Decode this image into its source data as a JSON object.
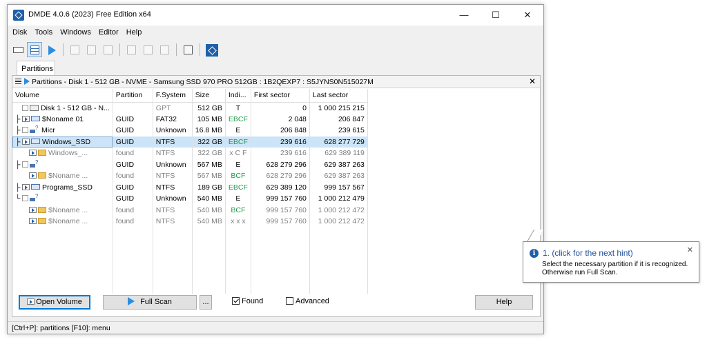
{
  "window": {
    "title": "DMDE 4.0.6 (2023) Free Edition x64",
    "minimize": "—",
    "maximize": "☐",
    "close": "✕"
  },
  "menu": [
    "Disk",
    "Tools",
    "Windows",
    "Editor",
    "Help"
  ],
  "tab": {
    "label": "Partitions"
  },
  "panel": {
    "title": "Partitions - Disk 1 - 512 GB - NVME - Samsung SSD 970 PRO 512GB : 1B2QEXP7 : S5JYNS0N515027M",
    "close": "✕"
  },
  "columns": [
    "Volume",
    "Partition",
    "F.System",
    "Size",
    "Indi...",
    "First sector",
    "Last sector"
  ],
  "rows": [
    {
      "volume": "Disk 1 - 512 GB - N...",
      "partition": "",
      "fs": "GPT",
      "size": "512 GB",
      "ind": "T",
      "first": "0",
      "last": "1 000 215 215"
    },
    {
      "volume": "$Noname 01",
      "partition": "GUID",
      "fs": "FAT32",
      "size": "105 MB",
      "ind": "EBCF",
      "first": "2 048",
      "last": "206 847"
    },
    {
      "volume": "Micr",
      "partition": "GUID",
      "fs": "Unknown",
      "size": "16.8 MB",
      "ind": "E",
      "first": "206 848",
      "last": "239 615"
    },
    {
      "volume": "Windows_SSD",
      "partition": "GUID",
      "fs": "NTFS",
      "size": "322 GB",
      "ind": "EBCF",
      "first": "239 616",
      "last": "628 277 729"
    },
    {
      "volume": "Windows_...",
      "partition": "found",
      "fs": "NTFS",
      "size": "322 GB",
      "ind": "x C F",
      "first": "239 616",
      "last": "629 389 119"
    },
    {
      "volume": "",
      "partition": "GUID",
      "fs": "Unknown",
      "size": "567 MB",
      "ind": "E",
      "first": "628 279 296",
      "last": "629 387 263"
    },
    {
      "volume": "$Noname ...",
      "partition": "found",
      "fs": "NTFS",
      "size": "567 MB",
      "ind": "BCF",
      "first": "628 279 296",
      "last": "629 387 263"
    },
    {
      "volume": "Programs_SSD",
      "partition": "GUID",
      "fs": "NTFS",
      "size": "189 GB",
      "ind": "EBCF",
      "first": "629 389 120",
      "last": "999 157 567"
    },
    {
      "volume": "",
      "partition": "GUID",
      "fs": "Unknown",
      "size": "540 MB",
      "ind": "E",
      "first": "999 157 760",
      "last": "1 000 212 479"
    },
    {
      "volume": "$Noname ...",
      "partition": "found",
      "fs": "NTFS",
      "size": "540 MB",
      "ind": "BCF",
      "first": "999 157 760",
      "last": "1 000 212 472"
    },
    {
      "volume": "$Noname ...",
      "partition": "found",
      "fs": "NTFS",
      "size": "540 MB",
      "ind": "x x x",
      "first": "999 157 760",
      "last": "1 000 212 472"
    }
  ],
  "buttons": {
    "open_volume": "Open Volume",
    "full_scan": "Full Scan",
    "dots": "...",
    "help": "Help"
  },
  "checks": {
    "found": "Found",
    "advanced": "Advanced"
  },
  "status": "[Ctrl+P]: partitions  [F10]: menu",
  "hint": {
    "icon": "i",
    "title": "1. (click for the next hint)",
    "close": "✕",
    "line1": "Select the necessary partition if it is recognized.",
    "line2": "Otherwise run Full Scan."
  },
  "colors": {
    "selection": "#cce4f7",
    "accent": "#1f5fa8",
    "indicator_green": "#1f9a4a"
  }
}
